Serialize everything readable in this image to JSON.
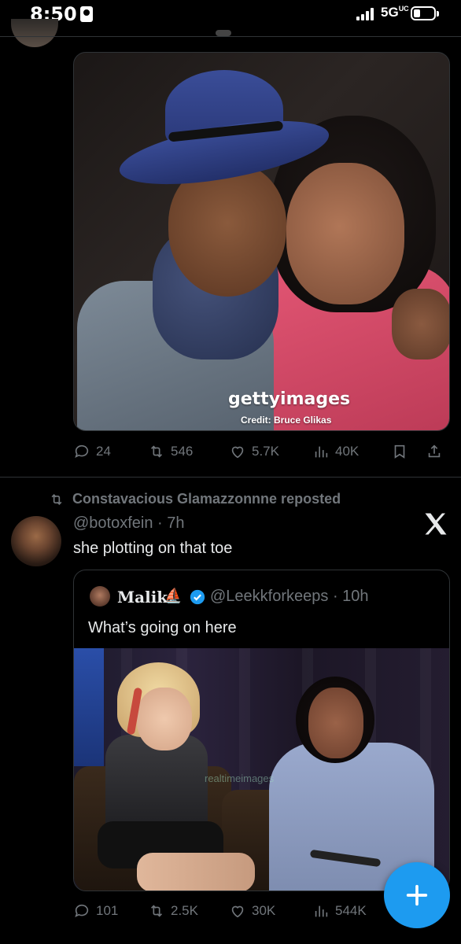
{
  "status_bar": {
    "time": "8:50",
    "network": "5G",
    "network_sub": "UC"
  },
  "tweet1": {
    "image": {
      "watermark_brand": "gettyimages",
      "credit": "Credit: Bruce Glikas"
    },
    "stats": {
      "replies": "24",
      "reposts": "546",
      "likes": "5.7K",
      "views": "40K"
    }
  },
  "tweet2": {
    "repost_label": "Constavacious Glamazzonnne reposted",
    "handle": "@botoxfein",
    "time": "7h",
    "text": "she plotting on that toe",
    "quote": {
      "name": "Malik",
      "name_emoji": "⛵",
      "handle": "@Leekkforkeeps",
      "time": "10h",
      "text": "What’s going on here",
      "image_watermark": "realtimeimages"
    },
    "stats": {
      "replies": "101",
      "reposts": "2.5K",
      "likes": "30K",
      "views": "544K"
    }
  },
  "icons": [
    "sim-icon",
    "signal-icon",
    "battery-icon",
    "reply-icon",
    "repost-icon",
    "like-icon",
    "views-icon",
    "bookmark-icon",
    "share-icon",
    "x-logo-icon",
    "verified-icon",
    "compose-plus-icon"
  ],
  "colors": {
    "accent": "#1d9bf0",
    "muted": "#71767b",
    "text": "#e7e9ea",
    "background": "#000000"
  }
}
